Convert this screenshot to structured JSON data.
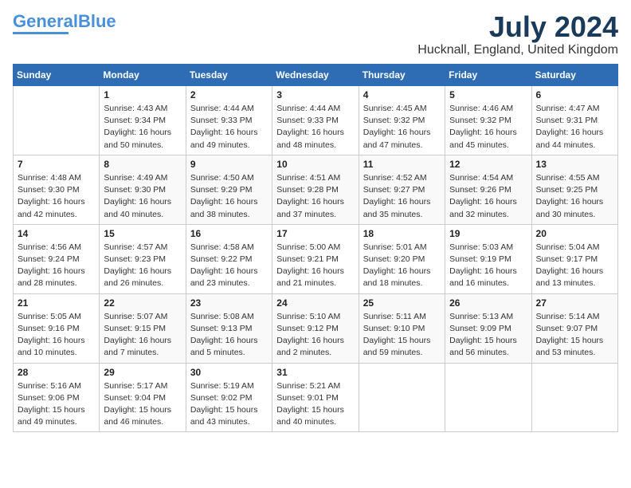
{
  "header": {
    "logo_line1": "General",
    "logo_line2": "Blue",
    "month_title": "July 2024",
    "location": "Hucknall, England, United Kingdom"
  },
  "days_of_week": [
    "Sunday",
    "Monday",
    "Tuesday",
    "Wednesday",
    "Thursday",
    "Friday",
    "Saturday"
  ],
  "weeks": [
    [
      {
        "day": "",
        "content": ""
      },
      {
        "day": "1",
        "content": "Sunrise: 4:43 AM\nSunset: 9:34 PM\nDaylight: 16 hours\nand 50 minutes."
      },
      {
        "day": "2",
        "content": "Sunrise: 4:44 AM\nSunset: 9:33 PM\nDaylight: 16 hours\nand 49 minutes."
      },
      {
        "day": "3",
        "content": "Sunrise: 4:44 AM\nSunset: 9:33 PM\nDaylight: 16 hours\nand 48 minutes."
      },
      {
        "day": "4",
        "content": "Sunrise: 4:45 AM\nSunset: 9:32 PM\nDaylight: 16 hours\nand 47 minutes."
      },
      {
        "day": "5",
        "content": "Sunrise: 4:46 AM\nSunset: 9:32 PM\nDaylight: 16 hours\nand 45 minutes."
      },
      {
        "day": "6",
        "content": "Sunrise: 4:47 AM\nSunset: 9:31 PM\nDaylight: 16 hours\nand 44 minutes."
      }
    ],
    [
      {
        "day": "7",
        "content": "Sunrise: 4:48 AM\nSunset: 9:30 PM\nDaylight: 16 hours\nand 42 minutes."
      },
      {
        "day": "8",
        "content": "Sunrise: 4:49 AM\nSunset: 9:30 PM\nDaylight: 16 hours\nand 40 minutes."
      },
      {
        "day": "9",
        "content": "Sunrise: 4:50 AM\nSunset: 9:29 PM\nDaylight: 16 hours\nand 38 minutes."
      },
      {
        "day": "10",
        "content": "Sunrise: 4:51 AM\nSunset: 9:28 PM\nDaylight: 16 hours\nand 37 minutes."
      },
      {
        "day": "11",
        "content": "Sunrise: 4:52 AM\nSunset: 9:27 PM\nDaylight: 16 hours\nand 35 minutes."
      },
      {
        "day": "12",
        "content": "Sunrise: 4:54 AM\nSunset: 9:26 PM\nDaylight: 16 hours\nand 32 minutes."
      },
      {
        "day": "13",
        "content": "Sunrise: 4:55 AM\nSunset: 9:25 PM\nDaylight: 16 hours\nand 30 minutes."
      }
    ],
    [
      {
        "day": "14",
        "content": "Sunrise: 4:56 AM\nSunset: 9:24 PM\nDaylight: 16 hours\nand 28 minutes."
      },
      {
        "day": "15",
        "content": "Sunrise: 4:57 AM\nSunset: 9:23 PM\nDaylight: 16 hours\nand 26 minutes."
      },
      {
        "day": "16",
        "content": "Sunrise: 4:58 AM\nSunset: 9:22 PM\nDaylight: 16 hours\nand 23 minutes."
      },
      {
        "day": "17",
        "content": "Sunrise: 5:00 AM\nSunset: 9:21 PM\nDaylight: 16 hours\nand 21 minutes."
      },
      {
        "day": "18",
        "content": "Sunrise: 5:01 AM\nSunset: 9:20 PM\nDaylight: 16 hours\nand 18 minutes."
      },
      {
        "day": "19",
        "content": "Sunrise: 5:03 AM\nSunset: 9:19 PM\nDaylight: 16 hours\nand 16 minutes."
      },
      {
        "day": "20",
        "content": "Sunrise: 5:04 AM\nSunset: 9:17 PM\nDaylight: 16 hours\nand 13 minutes."
      }
    ],
    [
      {
        "day": "21",
        "content": "Sunrise: 5:05 AM\nSunset: 9:16 PM\nDaylight: 16 hours\nand 10 minutes."
      },
      {
        "day": "22",
        "content": "Sunrise: 5:07 AM\nSunset: 9:15 PM\nDaylight: 16 hours\nand 7 minutes."
      },
      {
        "day": "23",
        "content": "Sunrise: 5:08 AM\nSunset: 9:13 PM\nDaylight: 16 hours\nand 5 minutes."
      },
      {
        "day": "24",
        "content": "Sunrise: 5:10 AM\nSunset: 9:12 PM\nDaylight: 16 hours\nand 2 minutes."
      },
      {
        "day": "25",
        "content": "Sunrise: 5:11 AM\nSunset: 9:10 PM\nDaylight: 15 hours\nand 59 minutes."
      },
      {
        "day": "26",
        "content": "Sunrise: 5:13 AM\nSunset: 9:09 PM\nDaylight: 15 hours\nand 56 minutes."
      },
      {
        "day": "27",
        "content": "Sunrise: 5:14 AM\nSunset: 9:07 PM\nDaylight: 15 hours\nand 53 minutes."
      }
    ],
    [
      {
        "day": "28",
        "content": "Sunrise: 5:16 AM\nSunset: 9:06 PM\nDaylight: 15 hours\nand 49 minutes."
      },
      {
        "day": "29",
        "content": "Sunrise: 5:17 AM\nSunset: 9:04 PM\nDaylight: 15 hours\nand 46 minutes."
      },
      {
        "day": "30",
        "content": "Sunrise: 5:19 AM\nSunset: 9:02 PM\nDaylight: 15 hours\nand 43 minutes."
      },
      {
        "day": "31",
        "content": "Sunrise: 5:21 AM\nSunset: 9:01 PM\nDaylight: 15 hours\nand 40 minutes."
      },
      {
        "day": "",
        "content": ""
      },
      {
        "day": "",
        "content": ""
      },
      {
        "day": "",
        "content": ""
      }
    ]
  ]
}
